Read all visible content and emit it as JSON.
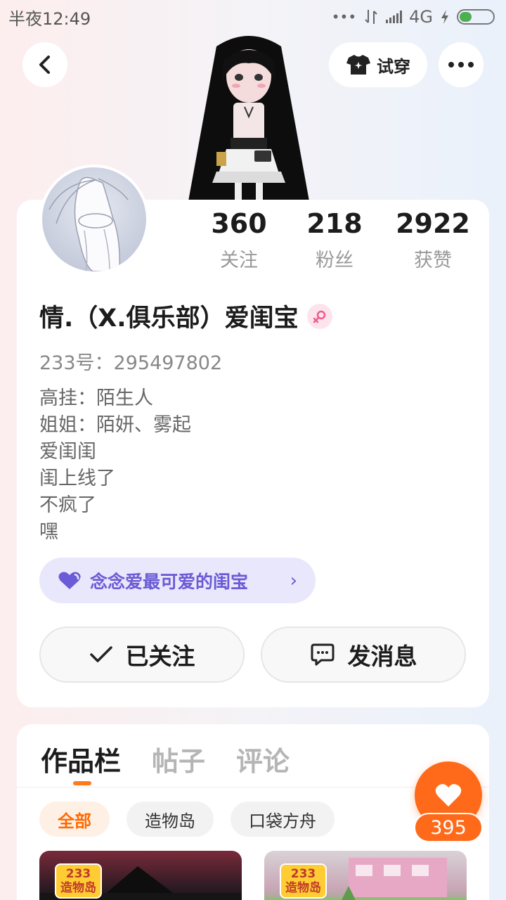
{
  "status_bar": {
    "time": "半夜12:49",
    "dots": "•••",
    "network": "4G"
  },
  "header": {
    "back_icon": "chevron-left-icon",
    "try_on_label": "试穿",
    "more_icon": "more-horizontal-icon"
  },
  "profile": {
    "stats": [
      {
        "value": "360",
        "label": "关注"
      },
      {
        "value": "218",
        "label": "粉丝"
      },
      {
        "value": "2922",
        "label": "获赞"
      }
    ],
    "nickname": "情.（X.俱乐部）爱闺宝",
    "gender": "female",
    "user_id": "233号：295497802",
    "bio": [
      "高挂：陌生人",
      "姐姐：陌妍、雾起",
      "爱闺闺",
      "闺上线了",
      "不疯了",
      "嘿"
    ],
    "fan_group": "念念爱最可爱的闺宝",
    "follow_label": "已关注",
    "message_label": "发消息"
  },
  "works": {
    "tabs": [
      "作品栏",
      "帖子",
      "评论"
    ],
    "active_tab": "作品栏",
    "chips": [
      "全部",
      "造物岛",
      "口袋方舟"
    ],
    "active_chip": "全部",
    "thumb_logo_top": "233",
    "thumb_logo_bottom": "造物岛"
  },
  "like_button": {
    "count": "395"
  },
  "colors": {
    "accent": "#ff6a1a",
    "fan_pill_bg": "#e9e7fb",
    "fan_pill_text": "#6a5bd6",
    "battery": "#4caf50"
  }
}
